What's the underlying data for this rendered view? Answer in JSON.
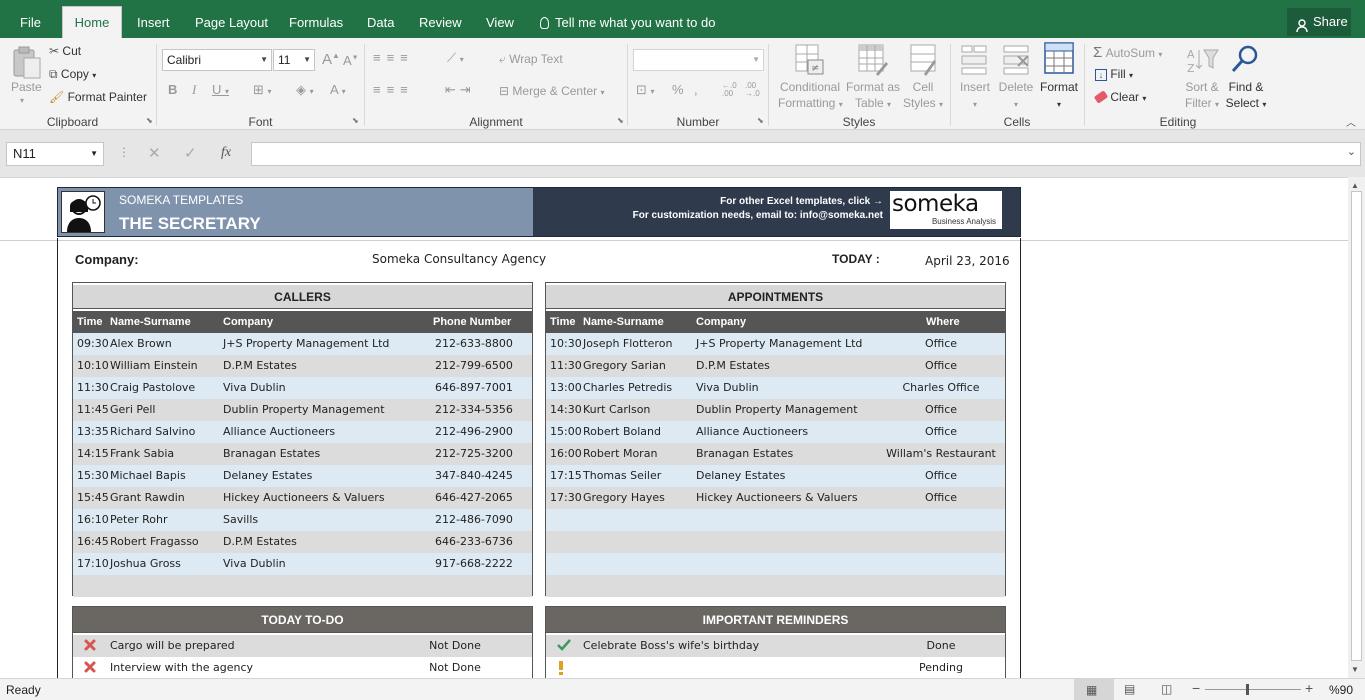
{
  "tabs": [
    "File",
    "Home",
    "Insert",
    "Page Layout",
    "Formulas",
    "Data",
    "Review",
    "View"
  ],
  "tell_me": "Tell me what you want to do",
  "share": "Share",
  "ribbon": {
    "paste": "Paste",
    "cut": "Cut",
    "copy": "Copy",
    "format_painter": "Format Painter",
    "clipboard": "Clipboard",
    "font_name": "Calibri",
    "font_size": "11",
    "font": "Font",
    "wrap_text": "Wrap Text",
    "merge_center": "Merge & Center",
    "alignment": "Alignment",
    "number": "Number",
    "percent": "%",
    "conditional_formatting": [
      "Conditional",
      "Formatting"
    ],
    "format_as_table": [
      "Format as",
      "Table"
    ],
    "cell_styles": [
      "Cell",
      "Styles"
    ],
    "styles": "Styles",
    "insert": "Insert",
    "delete": "Delete",
    "format": "Format",
    "cells": "Cells",
    "autosum": "AutoSum",
    "fill": "Fill",
    "clear": "Clear",
    "sort_filter": [
      "Sort &",
      "Filter"
    ],
    "find_select": [
      "Find &",
      "Select"
    ],
    "editing": "Editing"
  },
  "formula_bar": {
    "name_box": "N11",
    "fx": "fx",
    "value": ""
  },
  "banner": {
    "brand": "SOMEKA TEMPLATES",
    "title": "THE SECRETARY",
    "line1": "For other Excel templates, click →",
    "line2": "For customization needs, email to: info@someka.net",
    "logo": "someka",
    "logo_sub": "Business Analysis"
  },
  "info": {
    "company_label": "Company:",
    "company_value": "Someka Consultancy Agency",
    "today_label": "TODAY :",
    "today_value": "April 23, 2016"
  },
  "callers": {
    "title": "CALLERS",
    "headers": [
      "Time",
      "Name-Surname",
      "Company",
      "Phone Number"
    ],
    "rows": [
      [
        "09:30",
        "Alex Brown",
        "J+S Property Management Ltd",
        "212-633-8800"
      ],
      [
        "10:10",
        "William Einstein",
        "D.P.M Estates",
        "212-799-6500"
      ],
      [
        "11:30",
        "Craig Pastolove",
        "Viva Dublin",
        "646-897-7001"
      ],
      [
        "11:45",
        "Geri Pell",
        "Dublin Property Management",
        "212-334-5356"
      ],
      [
        "13:35",
        "Richard Salvino",
        "Alliance Auctioneers",
        "212-496-2900"
      ],
      [
        "14:15",
        "Frank Sabia",
        "Branagan Estates",
        "212-725-3200"
      ],
      [
        "15:30",
        "Michael Bapis",
        "Delaney Estates",
        "347-840-4245"
      ],
      [
        "15:45",
        "Grant Rawdin",
        "Hickey Auctioneers & Valuers",
        "646-427-2065"
      ],
      [
        "16:10",
        "Peter Rohr",
        "Savills",
        "212-486-7090"
      ],
      [
        "16:45",
        "Robert Fragasso",
        "D.P.M Estates",
        "646-233-6736"
      ],
      [
        "17:10",
        "Joshua Gross",
        "Viva Dublin",
        "917-668-2222"
      ],
      [
        "",
        "",
        "",
        ""
      ]
    ]
  },
  "appointments": {
    "title": "APPOINTMENTS",
    "headers": [
      "Time",
      "Name-Surname",
      "Company",
      "Where"
    ],
    "rows": [
      [
        "10:30",
        "Joseph Flotteron",
        "J+S Property Management Ltd",
        "Office"
      ],
      [
        "11:30",
        "Gregory Sarian",
        "D.P.M Estates",
        "Office"
      ],
      [
        "13:00",
        "Charles Petredis",
        "Viva Dublin",
        "Charles Office"
      ],
      [
        "14:30",
        "Kurt Carlson",
        "Dublin Property Management",
        "Office"
      ],
      [
        "15:00",
        "Robert Boland",
        "Alliance Auctioneers",
        "Office"
      ],
      [
        "16:00",
        "Robert Moran",
        "Branagan Estates",
        "Willam's Restaurant"
      ],
      [
        "17:15",
        "Thomas Seiler",
        "Delaney Estates",
        "Office"
      ],
      [
        "17:30",
        "Gregory Hayes",
        "Hickey Auctioneers & Valuers",
        "Office"
      ],
      [
        "",
        "",
        "",
        ""
      ],
      [
        "",
        "",
        "",
        ""
      ],
      [
        "",
        "",
        "",
        ""
      ],
      [
        "",
        "",
        "",
        ""
      ]
    ]
  },
  "todo": {
    "title": "TODAY TO-DO",
    "rows": [
      {
        "icon": "cross-icon",
        "text": "Cargo will be prepared",
        "status": "Not Done"
      },
      {
        "icon": "cross-icon",
        "text": "Interview with the agency",
        "status": "Not Done"
      }
    ]
  },
  "reminders": {
    "title": "IMPORTANT REMINDERS",
    "rows": [
      {
        "icon": "check-icon",
        "text": "Celebrate Boss's wife's birthday",
        "status": "Done"
      },
      {
        "icon": "exclamation-icon",
        "text": "",
        "status": "Pending"
      }
    ]
  },
  "status_bar": {
    "ready": "Ready",
    "zoom": "%90"
  },
  "colors": {
    "excel_green": "#217346",
    "banner_light": "#7f93ad",
    "banner_dark": "#2f3a4d",
    "header_dark": "#555555"
  }
}
